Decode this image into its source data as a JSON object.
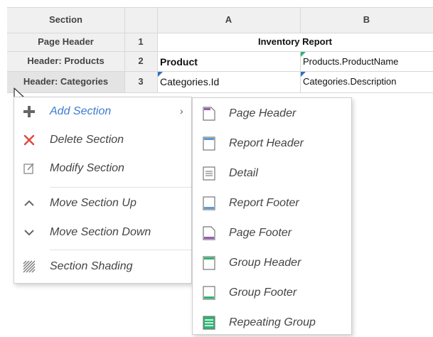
{
  "grid": {
    "columns": {
      "section": "Section",
      "A": "A",
      "B": "B"
    },
    "rows": [
      {
        "section": "Page Header",
        "num": "1",
        "a": "Inventory Report",
        "b": ""
      },
      {
        "section": "Header: Products",
        "num": "2",
        "a": "Product",
        "b": "Products.ProductName"
      },
      {
        "section": "Header: Categories",
        "num": "3",
        "a": "Categories.Id",
        "b": "Categories.Description"
      }
    ]
  },
  "context_menu": {
    "items": [
      {
        "label": "Add Section",
        "icon": "plus-icon"
      },
      {
        "label": "Delete Section",
        "icon": "x-icon"
      },
      {
        "label": "Modify Section",
        "icon": "edit-icon"
      },
      {
        "label": "Move Section Up",
        "icon": "chevron-up-icon"
      },
      {
        "label": "Move Section Down",
        "icon": "chevron-down-icon"
      },
      {
        "label": "Section Shading",
        "icon": "shading-icon"
      }
    ]
  },
  "submenu": {
    "items": [
      {
        "label": "Page Header"
      },
      {
        "label": "Report Header"
      },
      {
        "label": "Detail"
      },
      {
        "label": "Report Footer"
      },
      {
        "label": "Page Footer"
      },
      {
        "label": "Group Header"
      },
      {
        "label": "Group Footer"
      },
      {
        "label": "Repeating Group"
      }
    ]
  },
  "colors": {
    "accent": "#3d7bd4",
    "delete": "#e0473e",
    "purple": "#9b59b6",
    "blue": "#5b9bd5",
    "green": "#2bb673"
  }
}
